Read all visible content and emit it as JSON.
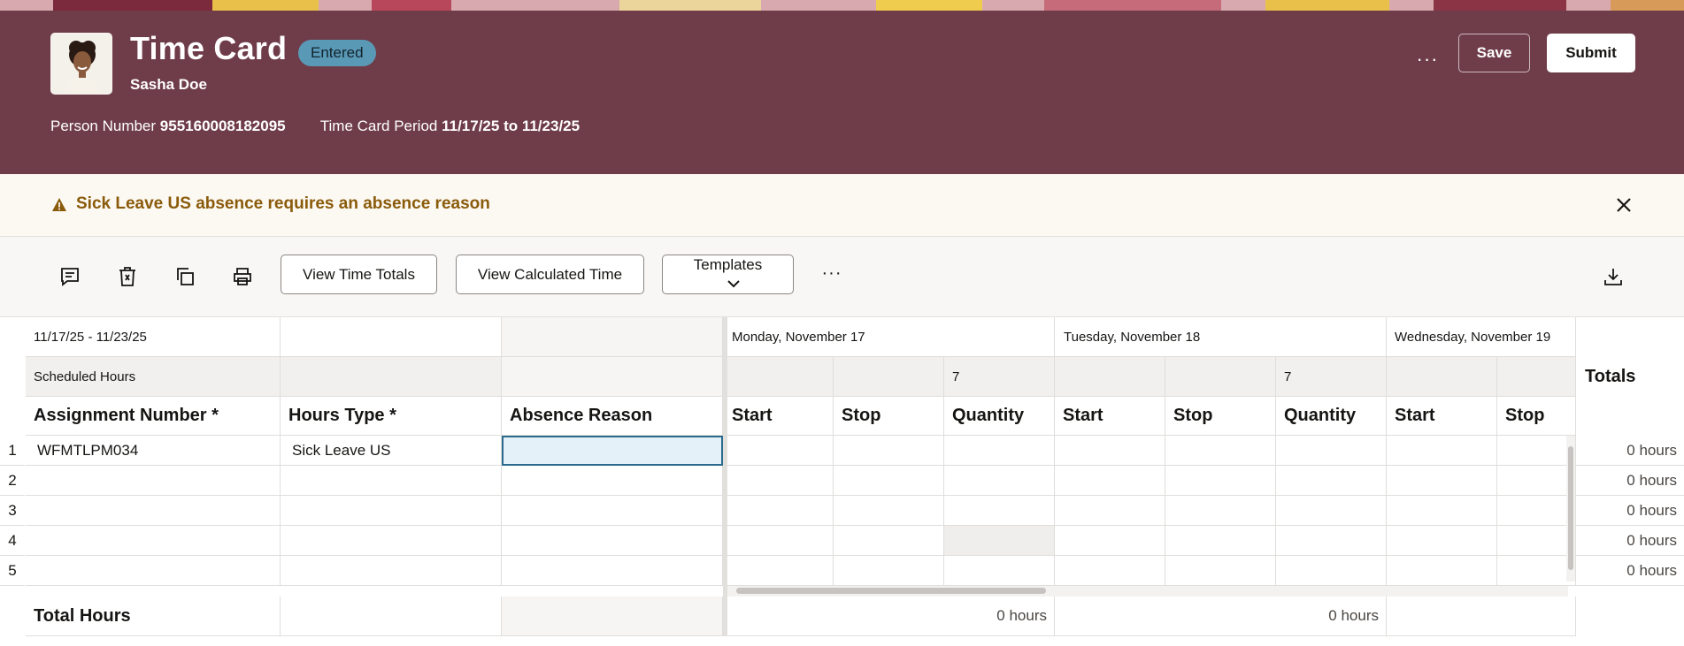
{
  "header": {
    "title": "Time Card",
    "status": "Entered",
    "person_name": "Sasha Doe",
    "person_number_label": "Person Number",
    "person_number": "955160008182095",
    "period_label": "Time Card Period",
    "period": "11/17/25 to 11/23/25",
    "more_label": "···",
    "save_label": "Save",
    "submit_label": "Submit",
    "colors": {
      "band": "#6f3d4a",
      "badge": "#5a99b6"
    }
  },
  "warning": {
    "message": "Sick Leave US absence requires an absence reason",
    "color": "#8a5b0b"
  },
  "toolbar": {
    "icons": [
      "comment-icon",
      "delete-icon",
      "copy-icon",
      "print-icon"
    ],
    "view_time_totals": "View Time Totals",
    "view_calculated_time": "View Calculated Time",
    "templates": "Templates",
    "more_label": "···",
    "download_icon": "download-icon"
  },
  "grid": {
    "date_range": "11/17/25 - 11/23/25",
    "scheduled_hours_label": "Scheduled Hours",
    "days": [
      {
        "label": "Monday, November 17",
        "scheduled": "7"
      },
      {
        "label": "Tuesday, November 18",
        "scheduled": "7"
      },
      {
        "label": "Wednesday, November 19",
        "scheduled": ""
      }
    ],
    "totals_label": "Totals",
    "columns": {
      "assignment": "Assignment Number *",
      "hours_type": "Hours Type *",
      "absence_reason": "Absence Reason",
      "start": "Start",
      "stop": "Stop",
      "quantity": "Quantity"
    },
    "rows": [
      {
        "num": "1",
        "assignment": "WFMTLPM034",
        "hours_type": "Sick Leave US",
        "absence_reason": "",
        "total": "0 hours"
      },
      {
        "num": "2",
        "assignment": "",
        "hours_type": "",
        "absence_reason": "",
        "total": "0 hours"
      },
      {
        "num": "3",
        "assignment": "",
        "hours_type": "",
        "absence_reason": "",
        "total": "0 hours"
      },
      {
        "num": "4",
        "assignment": "",
        "hours_type": "",
        "absence_reason": "",
        "total": "0 hours"
      },
      {
        "num": "5",
        "assignment": "",
        "hours_type": "",
        "absence_reason": "",
        "total": "0 hours"
      }
    ],
    "total_hours_label": "Total Hours",
    "day_totals": [
      "0 hours",
      "0 hours"
    ]
  }
}
